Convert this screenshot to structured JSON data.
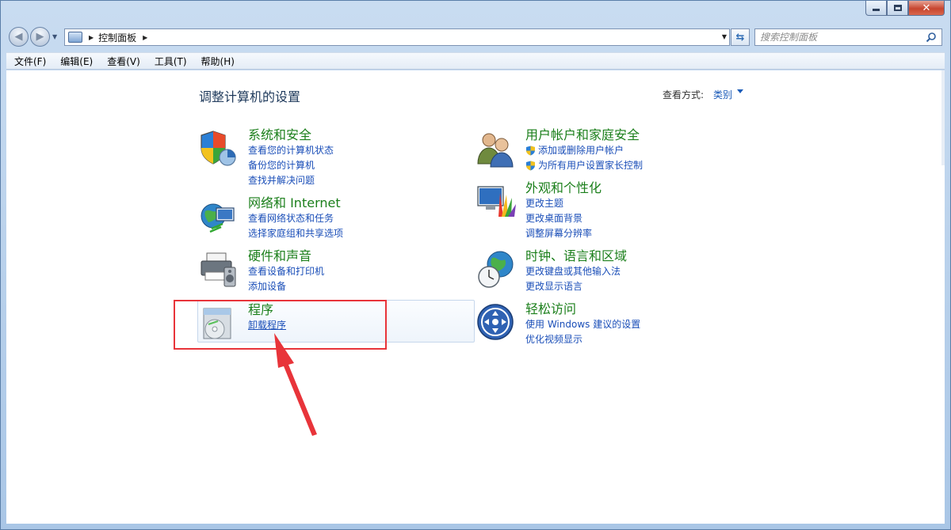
{
  "window": {
    "address_path": "控制面板",
    "search_placeholder": "搜索控制面板",
    "caption_close": "✕"
  },
  "menu": [
    "文件(F)",
    "编辑(E)",
    "查看(V)",
    "工具(T)",
    "帮助(H)"
  ],
  "content": {
    "title": "调整计算机的设置",
    "view_label": "查看方式:",
    "view_value": "类别"
  },
  "categories": [
    {
      "title": "系统和安全",
      "icon": "shield-icon",
      "links": [
        {
          "text": "查看您的计算机状态"
        },
        {
          "text": "备份您的计算机"
        },
        {
          "text": "查找并解决问题"
        }
      ]
    },
    {
      "title": "网络和 Internet",
      "icon": "network-globe-icon",
      "links": [
        {
          "text": "查看网络状态和任务"
        },
        {
          "text": "选择家庭组和共享选项"
        }
      ]
    },
    {
      "title": "硬件和声音",
      "icon": "printer-speaker-icon",
      "links": [
        {
          "text": "查看设备和打印机"
        },
        {
          "text": "添加设备"
        }
      ]
    },
    {
      "title": "程序",
      "icon": "programs-cd-icon",
      "links": [
        {
          "text": "卸载程序"
        }
      ]
    },
    {
      "title": "用户帐户和家庭安全",
      "icon": "users-icon",
      "links": [
        {
          "text": "添加或删除用户帐户",
          "uac": true
        },
        {
          "text": "为所有用户设置家长控制",
          "uac": true
        }
      ]
    },
    {
      "title": "外观和个性化",
      "icon": "monitor-palette-icon",
      "links": [
        {
          "text": "更改主题"
        },
        {
          "text": "更改桌面背景"
        },
        {
          "text": "调整屏幕分辨率"
        }
      ]
    },
    {
      "title": "时钟、语言和区域",
      "icon": "clock-globe-icon",
      "links": [
        {
          "text": "更改键盘或其他输入法"
        },
        {
          "text": "更改显示语言"
        }
      ]
    },
    {
      "title": "轻松访问",
      "icon": "ease-of-access-icon",
      "links": [
        {
          "text": "使用 Windows 建议的设置"
        },
        {
          "text": "优化视频显示"
        }
      ]
    }
  ],
  "colors": {
    "category_title": "#1b7f1b",
    "link": "#1a4eb8",
    "page_title": "#1e395b",
    "annotation": "#e8343a"
  }
}
